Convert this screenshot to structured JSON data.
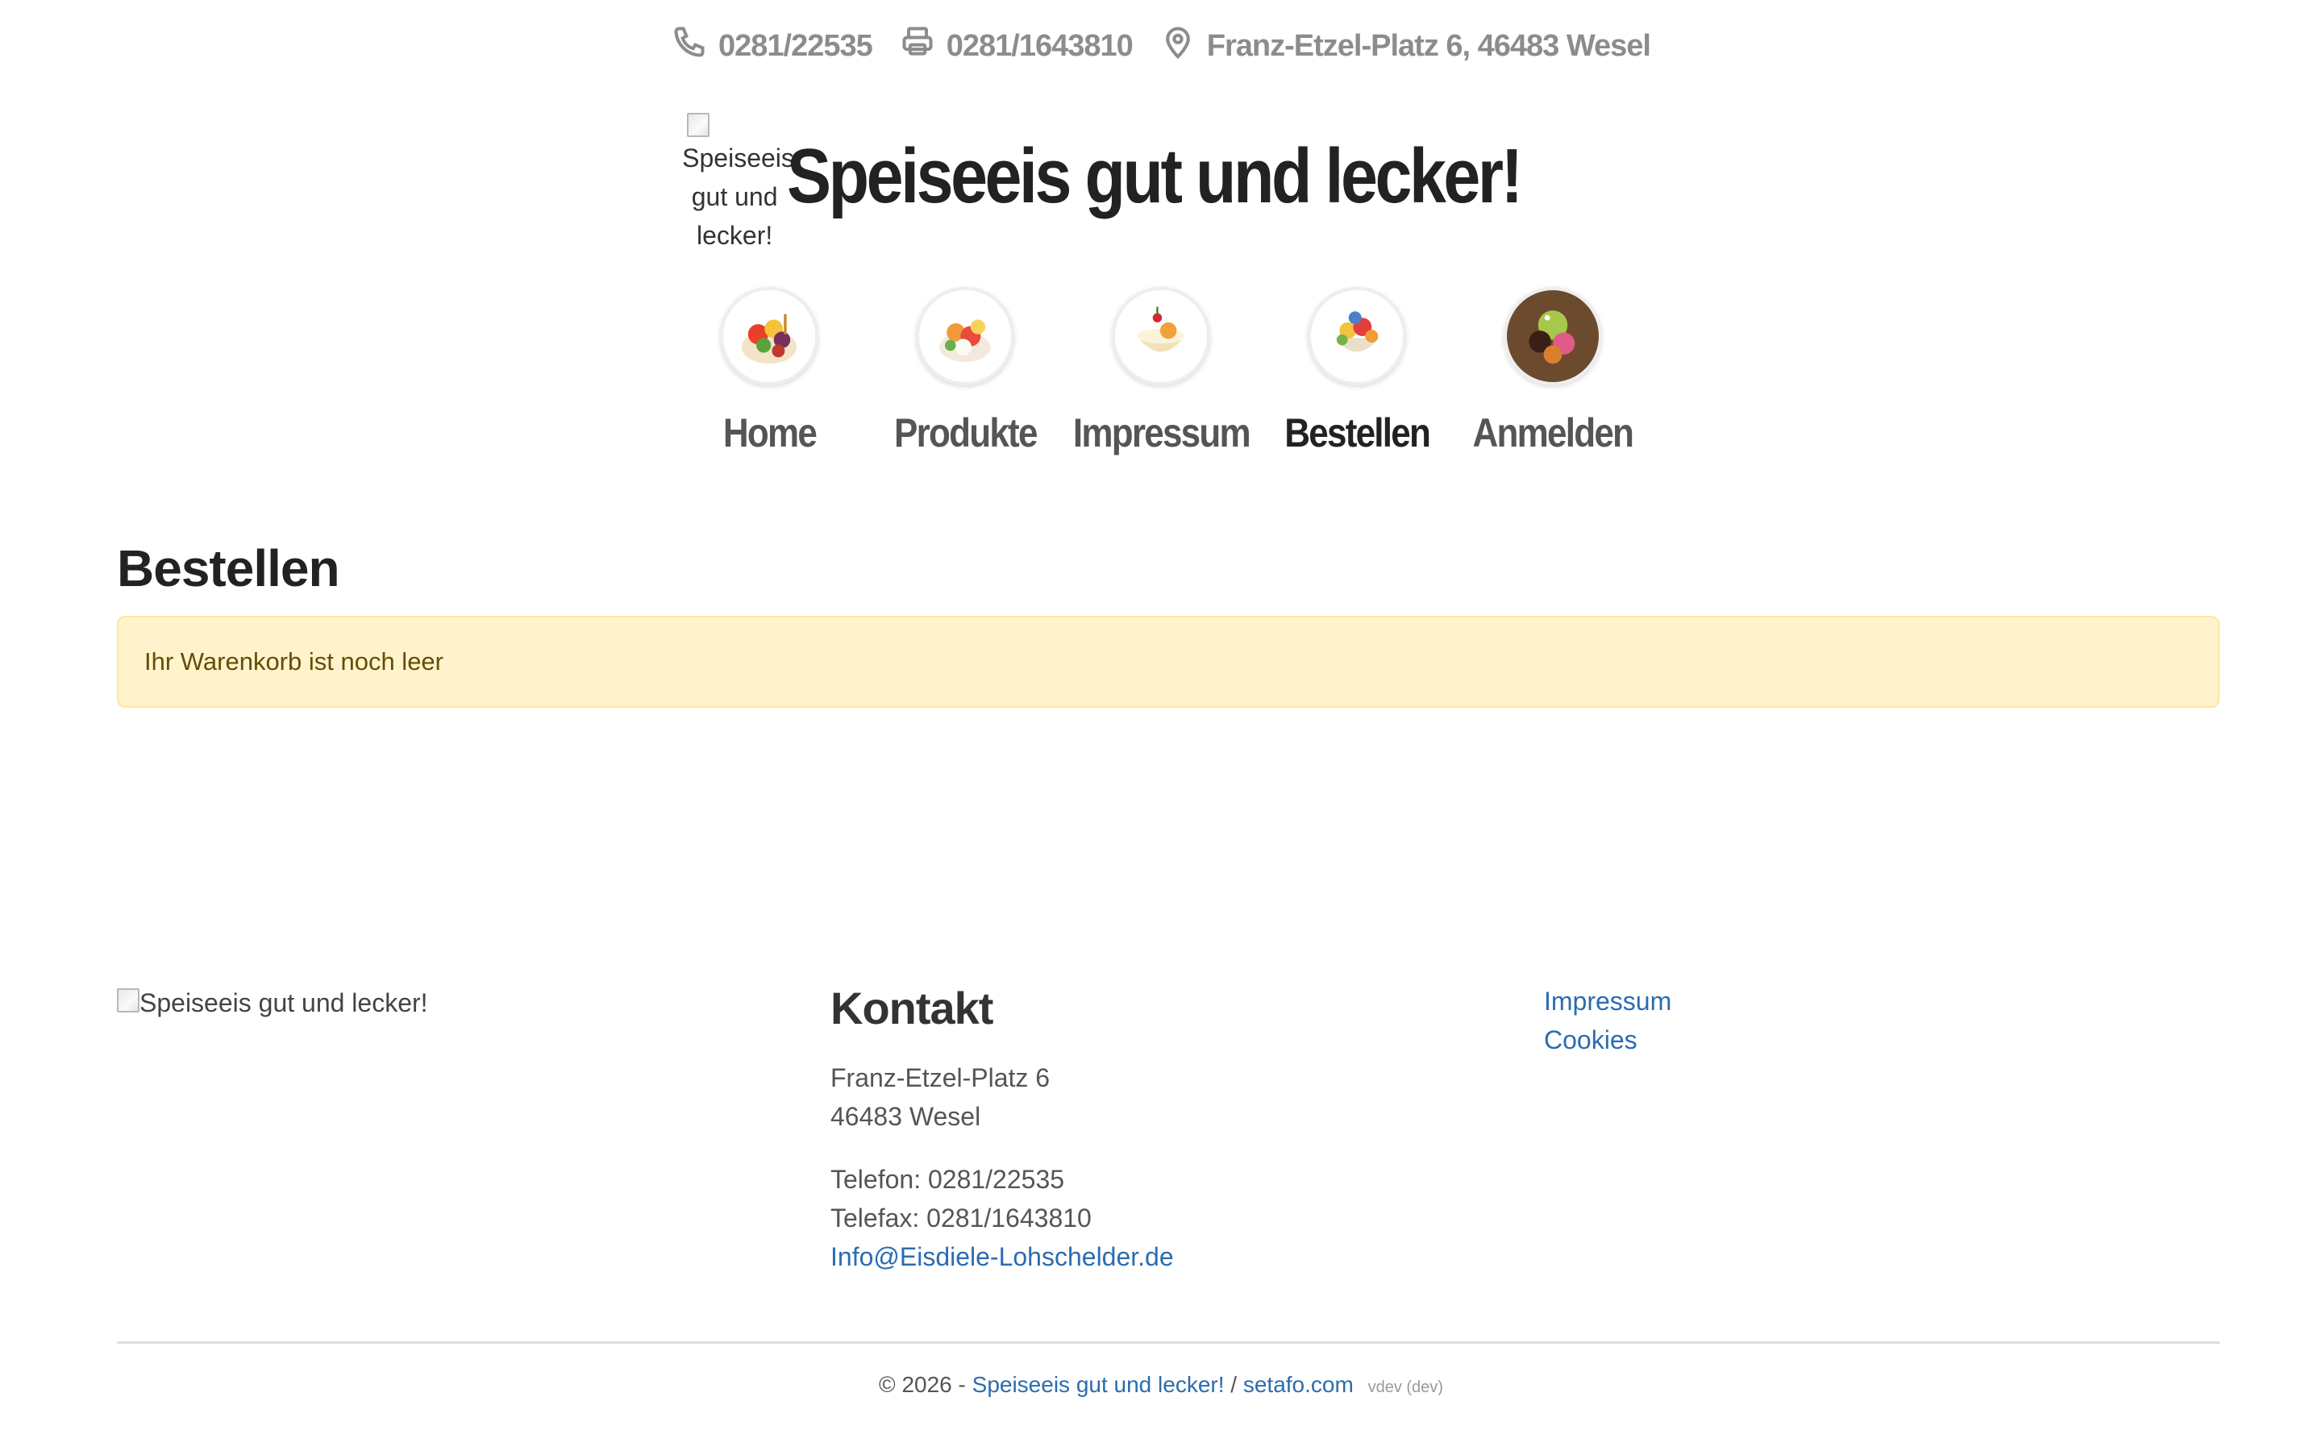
{
  "topbar": {
    "phone": "0281/22535",
    "fax": "0281/1643810",
    "address": "Franz-Etzel-Platz 6, 46483 Wesel",
    "icons": [
      "phone-icon",
      "printer-icon",
      "location-pin-icon"
    ]
  },
  "brand": {
    "logo_alt": "Speiseeis gut und lecker!",
    "title": "Speiseeis gut und lecker!"
  },
  "nav": {
    "items": [
      {
        "label": "Home"
      },
      {
        "label": "Produkte"
      },
      {
        "label": "Impressum"
      },
      {
        "label": "Bestellen",
        "active": true
      },
      {
        "label": "Anmelden"
      }
    ]
  },
  "main": {
    "heading": "Bestellen",
    "cart_message": "Ihr Warenkorb ist noch leer"
  },
  "footer": {
    "logo_alt": "Speiseeis gut und lecker!",
    "contact": {
      "heading": "Kontakt",
      "street": "Franz-Etzel-Platz 6",
      "city": "46483 Wesel",
      "phone": "Telefon: 0281/22535",
      "fax": "Telefax: 0281/1643810",
      "email": "Info@Eisdiele-Lohschelder.de"
    },
    "links": [
      "Impressum",
      "Cookies"
    ]
  },
  "copyright": {
    "prefix": "© 2026 -",
    "site_link": "Speiseeis gut und lecker!",
    "separator": "/",
    "vendor_link": "setafo.com",
    "version": "vdev (dev)"
  },
  "colors": {
    "alert_bg": "#fff3cd",
    "alert_border": "#ffe69c",
    "alert_text": "#664d03",
    "link": "#2b6cb0",
    "muted": "#8c8c8c"
  }
}
